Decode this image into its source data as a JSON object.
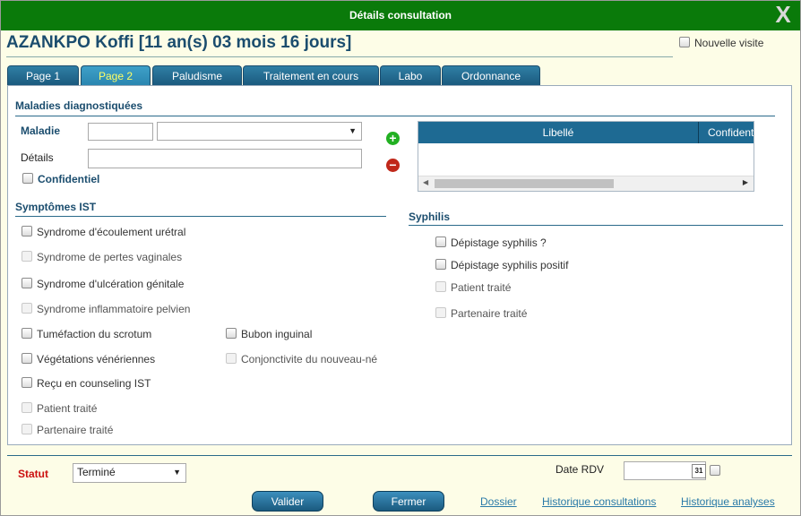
{
  "window": {
    "title": "Détails consultation",
    "close_label": "X"
  },
  "patient": {
    "name": "AZANKPO Koffi [11 an(s) 03 mois 16 jours]"
  },
  "nouvelle_visite": {
    "label": "Nouvelle visite",
    "checked": false
  },
  "tabs": [
    {
      "label": "Page 1",
      "active": false
    },
    {
      "label": "Page 2",
      "active": true
    },
    {
      "label": "Paludisme",
      "active": false
    },
    {
      "label": "Traitement en cours",
      "active": false
    },
    {
      "label": "Labo",
      "active": false
    },
    {
      "label": "Ordonnance",
      "active": false
    }
  ],
  "maladies": {
    "section_title": "Maladies diagnostiquées",
    "maladie_label": "Maladie",
    "details_label": "Détails",
    "confidentiel_label": "Confidentiel",
    "grid_columns": [
      "Libellé",
      "Confident"
    ]
  },
  "symptomes": {
    "section_title": "Symptômes IST",
    "items_left": [
      {
        "label": "Syndrome d'écoulement urétral",
        "enabled": true
      },
      {
        "label": "Syndrome de pertes vaginales",
        "enabled": false
      },
      {
        "label": "Syndrome d'ulcération génitale",
        "enabled": true
      },
      {
        "label": "Syndrome inflammatoire pelvien",
        "enabled": false
      },
      {
        "label": "Tuméfaction du scrotum",
        "enabled": true
      },
      {
        "label": "Végétations vénériennes",
        "enabled": true
      },
      {
        "label": "Reçu en counseling IST",
        "enabled": true
      },
      {
        "label": "Patient traité",
        "enabled": false
      },
      {
        "label": "Partenaire traité",
        "enabled": false
      }
    ],
    "items_right": [
      {
        "label": "Bubon inguinal",
        "enabled": true
      },
      {
        "label": "Conjonctivite du nouveau-né",
        "enabled": false
      }
    ]
  },
  "syphilis": {
    "section_title": "Syphilis",
    "items": [
      {
        "label": "Dépistage syphilis ?",
        "enabled": true
      },
      {
        "label": "Dépistage syphilis positif",
        "enabled": true
      },
      {
        "label": "Patient traité",
        "enabled": false
      },
      {
        "label": "Partenaire traité",
        "enabled": false
      }
    ]
  },
  "footer": {
    "statut_label": "Statut",
    "statut_value": "Terminé",
    "date_rdv_label": "Date RDV",
    "calendar_day": "31",
    "valider_label": "Valider",
    "fermer_label": "Fermer",
    "links": [
      "Dossier",
      "Historique consultations",
      "Historique analyses"
    ]
  },
  "colors": {
    "titlebar": "#0a7a0a",
    "tab": "#1b5a7e",
    "active_tab_text": "#ffff66",
    "statut": "#cc1111",
    "link": "#2a7aa8"
  }
}
